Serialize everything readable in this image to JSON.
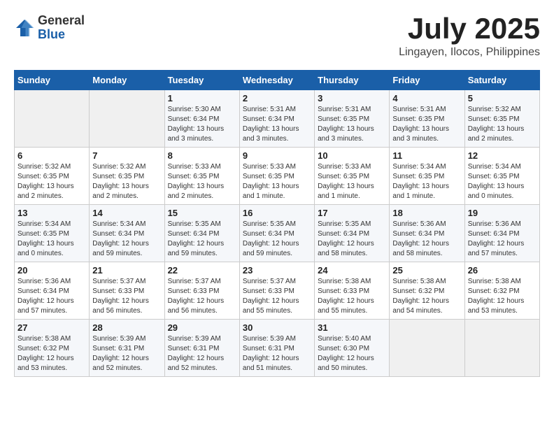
{
  "logo": {
    "general": "General",
    "blue": "Blue"
  },
  "title": {
    "month_year": "July 2025",
    "location": "Lingayen, Ilocos, Philippines"
  },
  "weekdays": [
    "Sunday",
    "Monday",
    "Tuesday",
    "Wednesday",
    "Thursday",
    "Friday",
    "Saturday"
  ],
  "weeks": [
    [
      {
        "day": "",
        "info": ""
      },
      {
        "day": "",
        "info": ""
      },
      {
        "day": "1",
        "info": "Sunrise: 5:30 AM\nSunset: 6:34 PM\nDaylight: 13 hours and 3 minutes."
      },
      {
        "day": "2",
        "info": "Sunrise: 5:31 AM\nSunset: 6:34 PM\nDaylight: 13 hours and 3 minutes."
      },
      {
        "day": "3",
        "info": "Sunrise: 5:31 AM\nSunset: 6:35 PM\nDaylight: 13 hours and 3 minutes."
      },
      {
        "day": "4",
        "info": "Sunrise: 5:31 AM\nSunset: 6:35 PM\nDaylight: 13 hours and 3 minutes."
      },
      {
        "day": "5",
        "info": "Sunrise: 5:32 AM\nSunset: 6:35 PM\nDaylight: 13 hours and 2 minutes."
      }
    ],
    [
      {
        "day": "6",
        "info": "Sunrise: 5:32 AM\nSunset: 6:35 PM\nDaylight: 13 hours and 2 minutes."
      },
      {
        "day": "7",
        "info": "Sunrise: 5:32 AM\nSunset: 6:35 PM\nDaylight: 13 hours and 2 minutes."
      },
      {
        "day": "8",
        "info": "Sunrise: 5:33 AM\nSunset: 6:35 PM\nDaylight: 13 hours and 2 minutes."
      },
      {
        "day": "9",
        "info": "Sunrise: 5:33 AM\nSunset: 6:35 PM\nDaylight: 13 hours and 1 minute."
      },
      {
        "day": "10",
        "info": "Sunrise: 5:33 AM\nSunset: 6:35 PM\nDaylight: 13 hours and 1 minute."
      },
      {
        "day": "11",
        "info": "Sunrise: 5:34 AM\nSunset: 6:35 PM\nDaylight: 13 hours and 1 minute."
      },
      {
        "day": "12",
        "info": "Sunrise: 5:34 AM\nSunset: 6:35 PM\nDaylight: 13 hours and 0 minutes."
      }
    ],
    [
      {
        "day": "13",
        "info": "Sunrise: 5:34 AM\nSunset: 6:35 PM\nDaylight: 13 hours and 0 minutes."
      },
      {
        "day": "14",
        "info": "Sunrise: 5:34 AM\nSunset: 6:34 PM\nDaylight: 12 hours and 59 minutes."
      },
      {
        "day": "15",
        "info": "Sunrise: 5:35 AM\nSunset: 6:34 PM\nDaylight: 12 hours and 59 minutes."
      },
      {
        "day": "16",
        "info": "Sunrise: 5:35 AM\nSunset: 6:34 PM\nDaylight: 12 hours and 59 minutes."
      },
      {
        "day": "17",
        "info": "Sunrise: 5:35 AM\nSunset: 6:34 PM\nDaylight: 12 hours and 58 minutes."
      },
      {
        "day": "18",
        "info": "Sunrise: 5:36 AM\nSunset: 6:34 PM\nDaylight: 12 hours and 58 minutes."
      },
      {
        "day": "19",
        "info": "Sunrise: 5:36 AM\nSunset: 6:34 PM\nDaylight: 12 hours and 57 minutes."
      }
    ],
    [
      {
        "day": "20",
        "info": "Sunrise: 5:36 AM\nSunset: 6:34 PM\nDaylight: 12 hours and 57 minutes."
      },
      {
        "day": "21",
        "info": "Sunrise: 5:37 AM\nSunset: 6:33 PM\nDaylight: 12 hours and 56 minutes."
      },
      {
        "day": "22",
        "info": "Sunrise: 5:37 AM\nSunset: 6:33 PM\nDaylight: 12 hours and 56 minutes."
      },
      {
        "day": "23",
        "info": "Sunrise: 5:37 AM\nSunset: 6:33 PM\nDaylight: 12 hours and 55 minutes."
      },
      {
        "day": "24",
        "info": "Sunrise: 5:38 AM\nSunset: 6:33 PM\nDaylight: 12 hours and 55 minutes."
      },
      {
        "day": "25",
        "info": "Sunrise: 5:38 AM\nSunset: 6:32 PM\nDaylight: 12 hours and 54 minutes."
      },
      {
        "day": "26",
        "info": "Sunrise: 5:38 AM\nSunset: 6:32 PM\nDaylight: 12 hours and 53 minutes."
      }
    ],
    [
      {
        "day": "27",
        "info": "Sunrise: 5:38 AM\nSunset: 6:32 PM\nDaylight: 12 hours and 53 minutes."
      },
      {
        "day": "28",
        "info": "Sunrise: 5:39 AM\nSunset: 6:31 PM\nDaylight: 12 hours and 52 minutes."
      },
      {
        "day": "29",
        "info": "Sunrise: 5:39 AM\nSunset: 6:31 PM\nDaylight: 12 hours and 52 minutes."
      },
      {
        "day": "30",
        "info": "Sunrise: 5:39 AM\nSunset: 6:31 PM\nDaylight: 12 hours and 51 minutes."
      },
      {
        "day": "31",
        "info": "Sunrise: 5:40 AM\nSunset: 6:30 PM\nDaylight: 12 hours and 50 minutes."
      },
      {
        "day": "",
        "info": ""
      },
      {
        "day": "",
        "info": ""
      }
    ]
  ]
}
